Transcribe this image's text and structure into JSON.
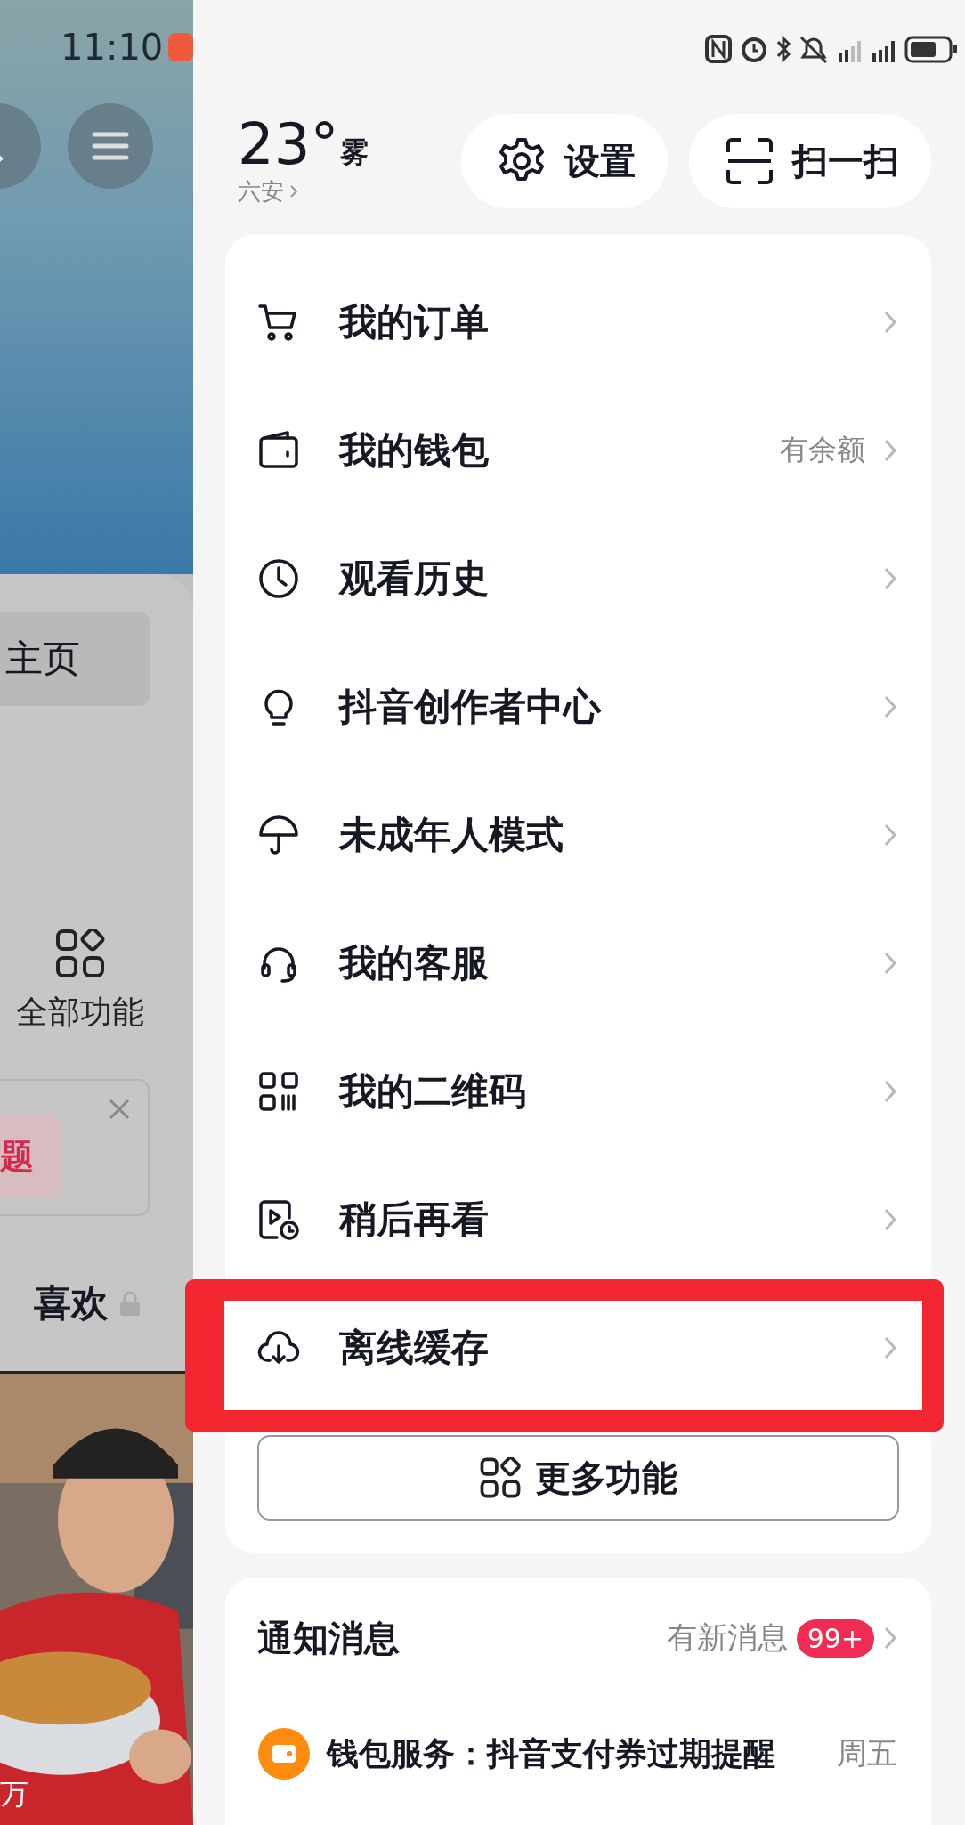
{
  "status_bar": {
    "time": "11:10"
  },
  "left_panel": {
    "profile_tab": "主页",
    "all_functions": "全部功能",
    "topic_tag": "题",
    "likes_tab": "喜欢",
    "video_count": "万"
  },
  "weather": {
    "temperature": "23°",
    "condition": "雾",
    "city": "六安"
  },
  "header_buttons": [
    {
      "label": "设置",
      "kind": "settings"
    },
    {
      "label": "扫一扫",
      "kind": "scan"
    }
  ],
  "menu": [
    {
      "label": "我的订单",
      "kind": "cart",
      "highlighted": false
    },
    {
      "label": "我的钱包",
      "kind": "wallet",
      "value": "有余额",
      "highlighted": false
    },
    {
      "label": "观看历史",
      "kind": "clock",
      "highlighted": false
    },
    {
      "label": "抖音创作者中心",
      "kind": "bulb",
      "highlighted": false
    },
    {
      "label": "未成年人模式",
      "kind": "umbrella",
      "highlighted": false
    },
    {
      "label": "我的客服",
      "kind": "headset",
      "highlighted": false
    },
    {
      "label": "我的二维码",
      "kind": "qrcode",
      "highlighted": false
    },
    {
      "label": "稍后再看",
      "kind": "later",
      "highlighted": false
    },
    {
      "label": "离线缓存",
      "kind": "download",
      "highlighted": true
    }
  ],
  "more_button": "更多功能",
  "notifications": {
    "title": "通知消息",
    "summary": "有新消息",
    "badge": "99+",
    "items": [
      {
        "text": "钱包服务：抖音支付券过期提醒",
        "time": "周五"
      }
    ]
  }
}
